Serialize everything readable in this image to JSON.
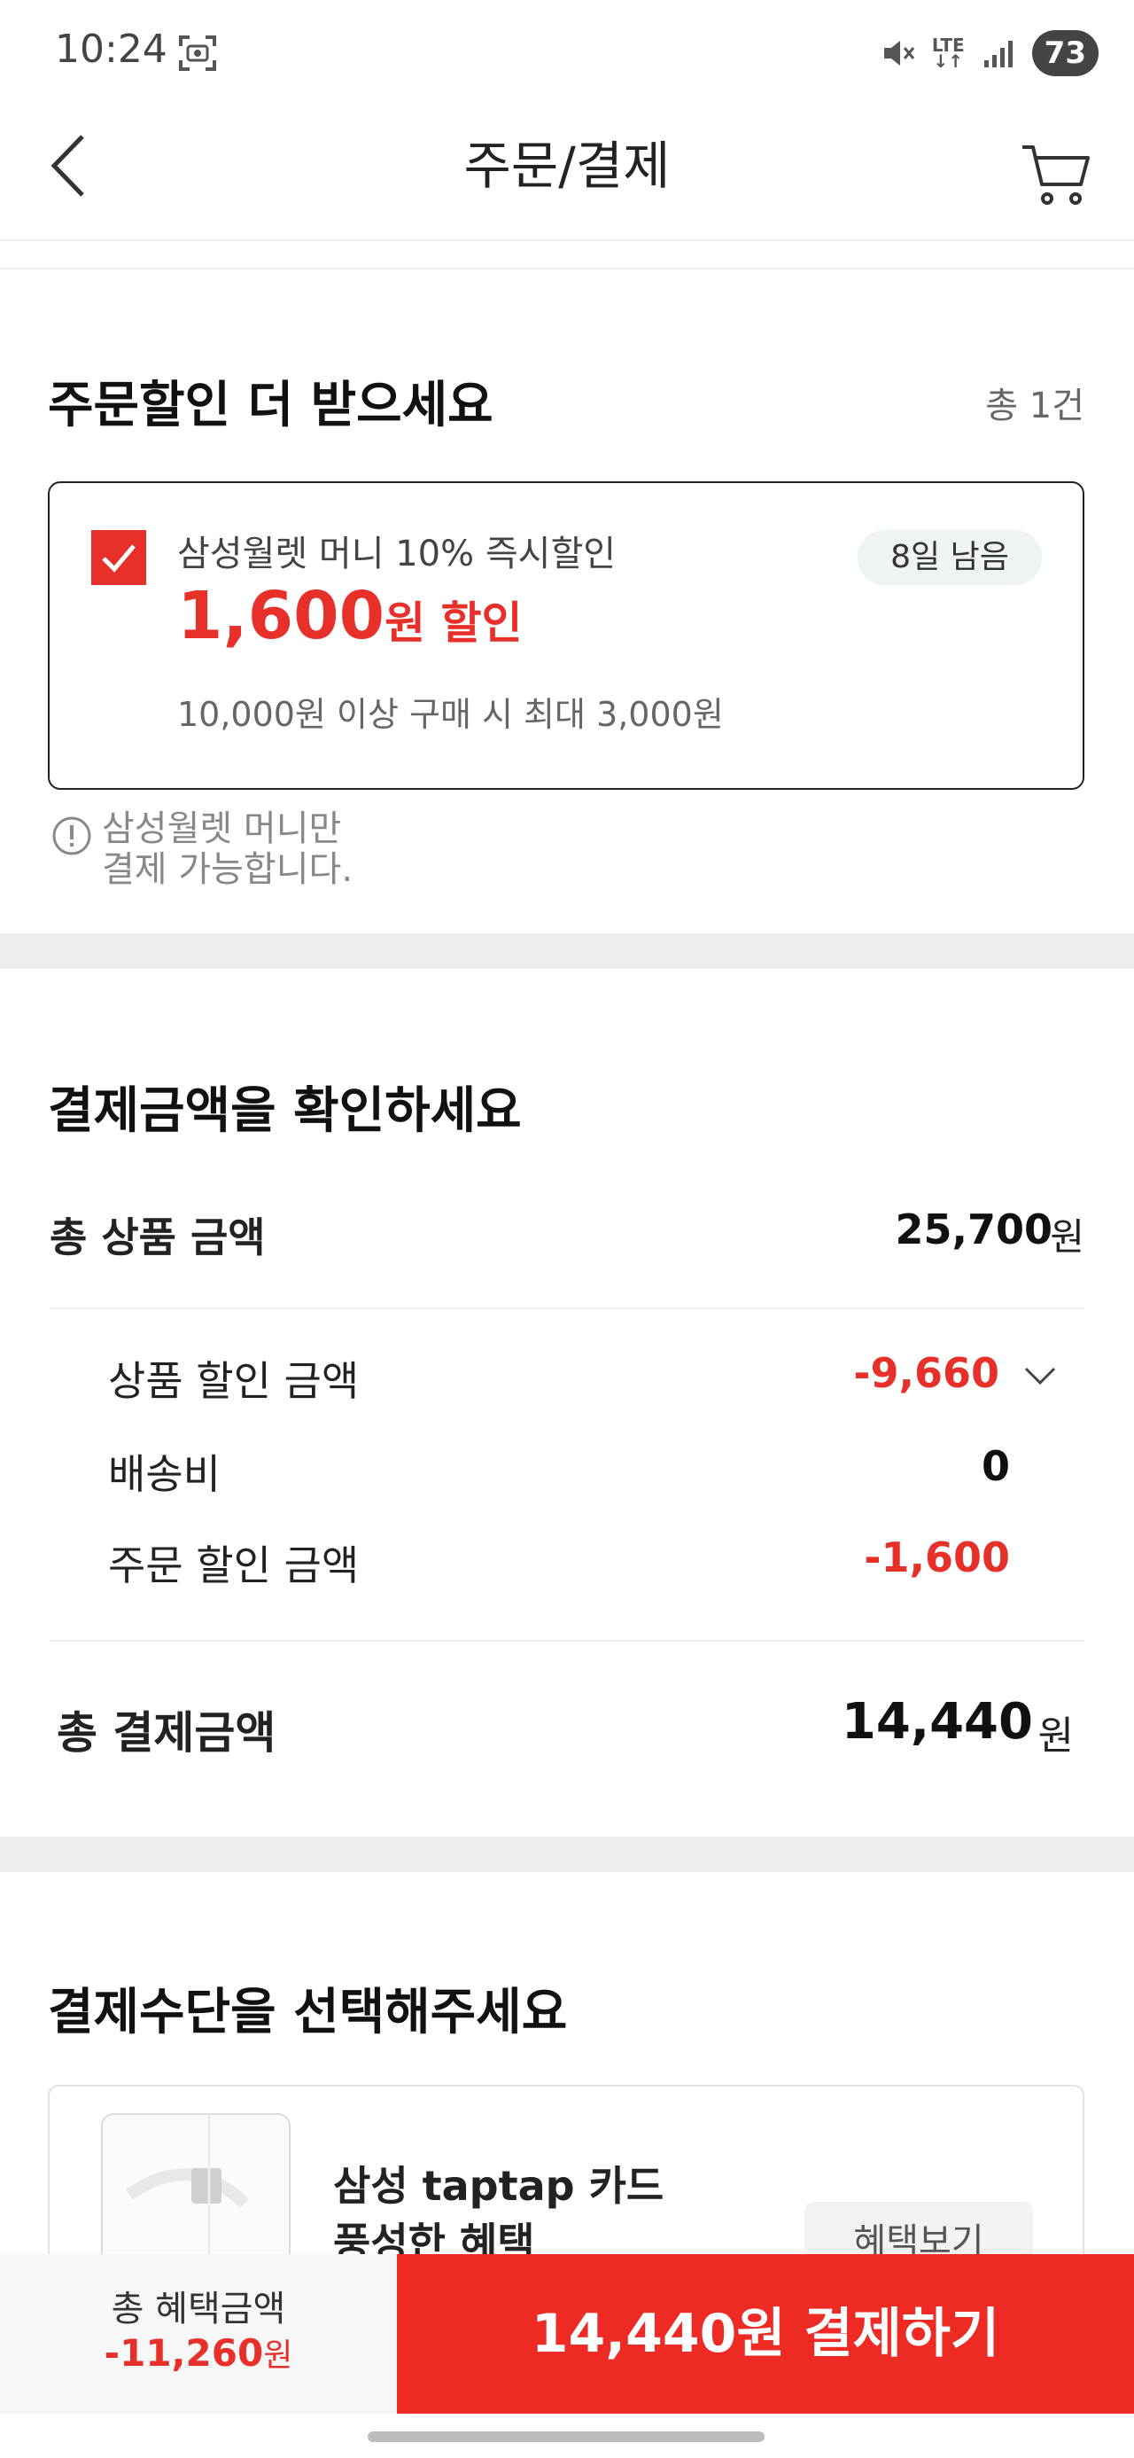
{
  "status_bar": {
    "time": "10:24",
    "network": "LTE",
    "battery": "73"
  },
  "header": {
    "title": "주문/결제"
  },
  "order_discount": {
    "title": "주문할인 더 받으세요",
    "count": "총 1건",
    "coupon": {
      "name": "삼성월렛 머니 10% 즉시할인",
      "amount": "1,600",
      "amount_suffix": "원 할인",
      "badge": "8일 남음",
      "condition": "10,000원 이상 구매 시 최대 3,000원",
      "checked": true
    },
    "notice_line1": "삼성월렛 머니만",
    "notice_line2": "결제 가능합니다."
  },
  "payment_summary": {
    "title": "결제금액을 확인하세요",
    "total_product_label": "총 상품 금액",
    "total_product_value": "25,700",
    "won": "원",
    "product_discount_label": "상품 할인 금액",
    "product_discount_value": "-9,660",
    "shipping_label": "배송비",
    "shipping_value": "0",
    "order_discount_label": "주문 할인 금액",
    "order_discount_value": "-1,600",
    "total_pay_label": "총 결제금액",
    "total_pay_value": "14,440"
  },
  "payment_method": {
    "title": "결제수단을 선택해주세요",
    "card_title_line1": "삼성 taptap 카드",
    "card_title_line2": "풍성한 혜택",
    "benefit_button": "혜택보기"
  },
  "bottom_bar": {
    "benefit_label": "총 혜택금액",
    "benefit_value": "-11,260",
    "benefit_unit": "원",
    "pay_button": "14,440원 결제하기"
  },
  "colors": {
    "accent": "#e8302a",
    "pay_button": "#ee2a24"
  }
}
